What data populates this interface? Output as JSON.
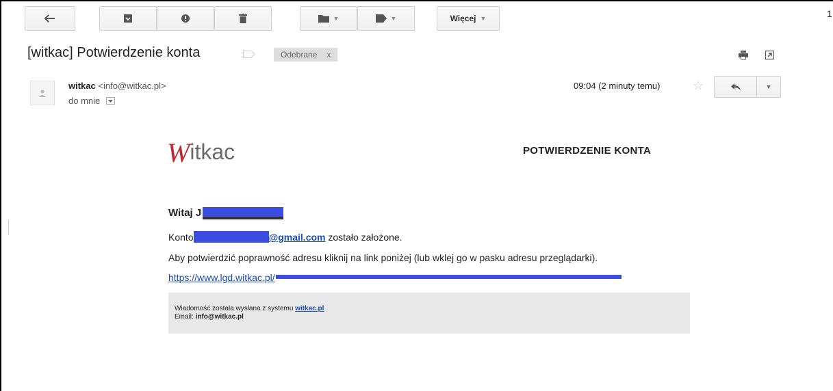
{
  "toolbar": {
    "more_label": "Więcej",
    "top_count": "1"
  },
  "message": {
    "subject": "[witkac] Potwierdzenie konta",
    "label_chip": "Odebrane",
    "label_chip_close": "x",
    "sender_name": "witkac",
    "sender_email": "<info@witkac.pl>",
    "recipient": "do mnie",
    "time": "09:04 (2 minuty temu)"
  },
  "email_body": {
    "logo_w": "W",
    "logo_rest": "itkac",
    "heading": "POTWIERDZENIE KONTA",
    "greeting": "Witaj J",
    "konto_prefix": "Konto",
    "konto_email_suffix": "@gmail.com",
    "konto_suffix": " zostało założone.",
    "instruction": "Aby potwierdzić poprawność adresu kliknij na link poniżej (lub wklej go w pasku adresu przeglądarki).",
    "link_visible": "https://www.lgd.witkac.pl/",
    "footer_text": "Wiadomość została wysłana z systemu ",
    "footer_link": "witkac.pl",
    "footer_email_label": "Email: ",
    "footer_email": "info@witkac.pl"
  },
  "colors": {
    "accent_red": "#c1272d",
    "link_blue": "#1a4bb8",
    "redaction_blue": "#3a4de0"
  }
}
